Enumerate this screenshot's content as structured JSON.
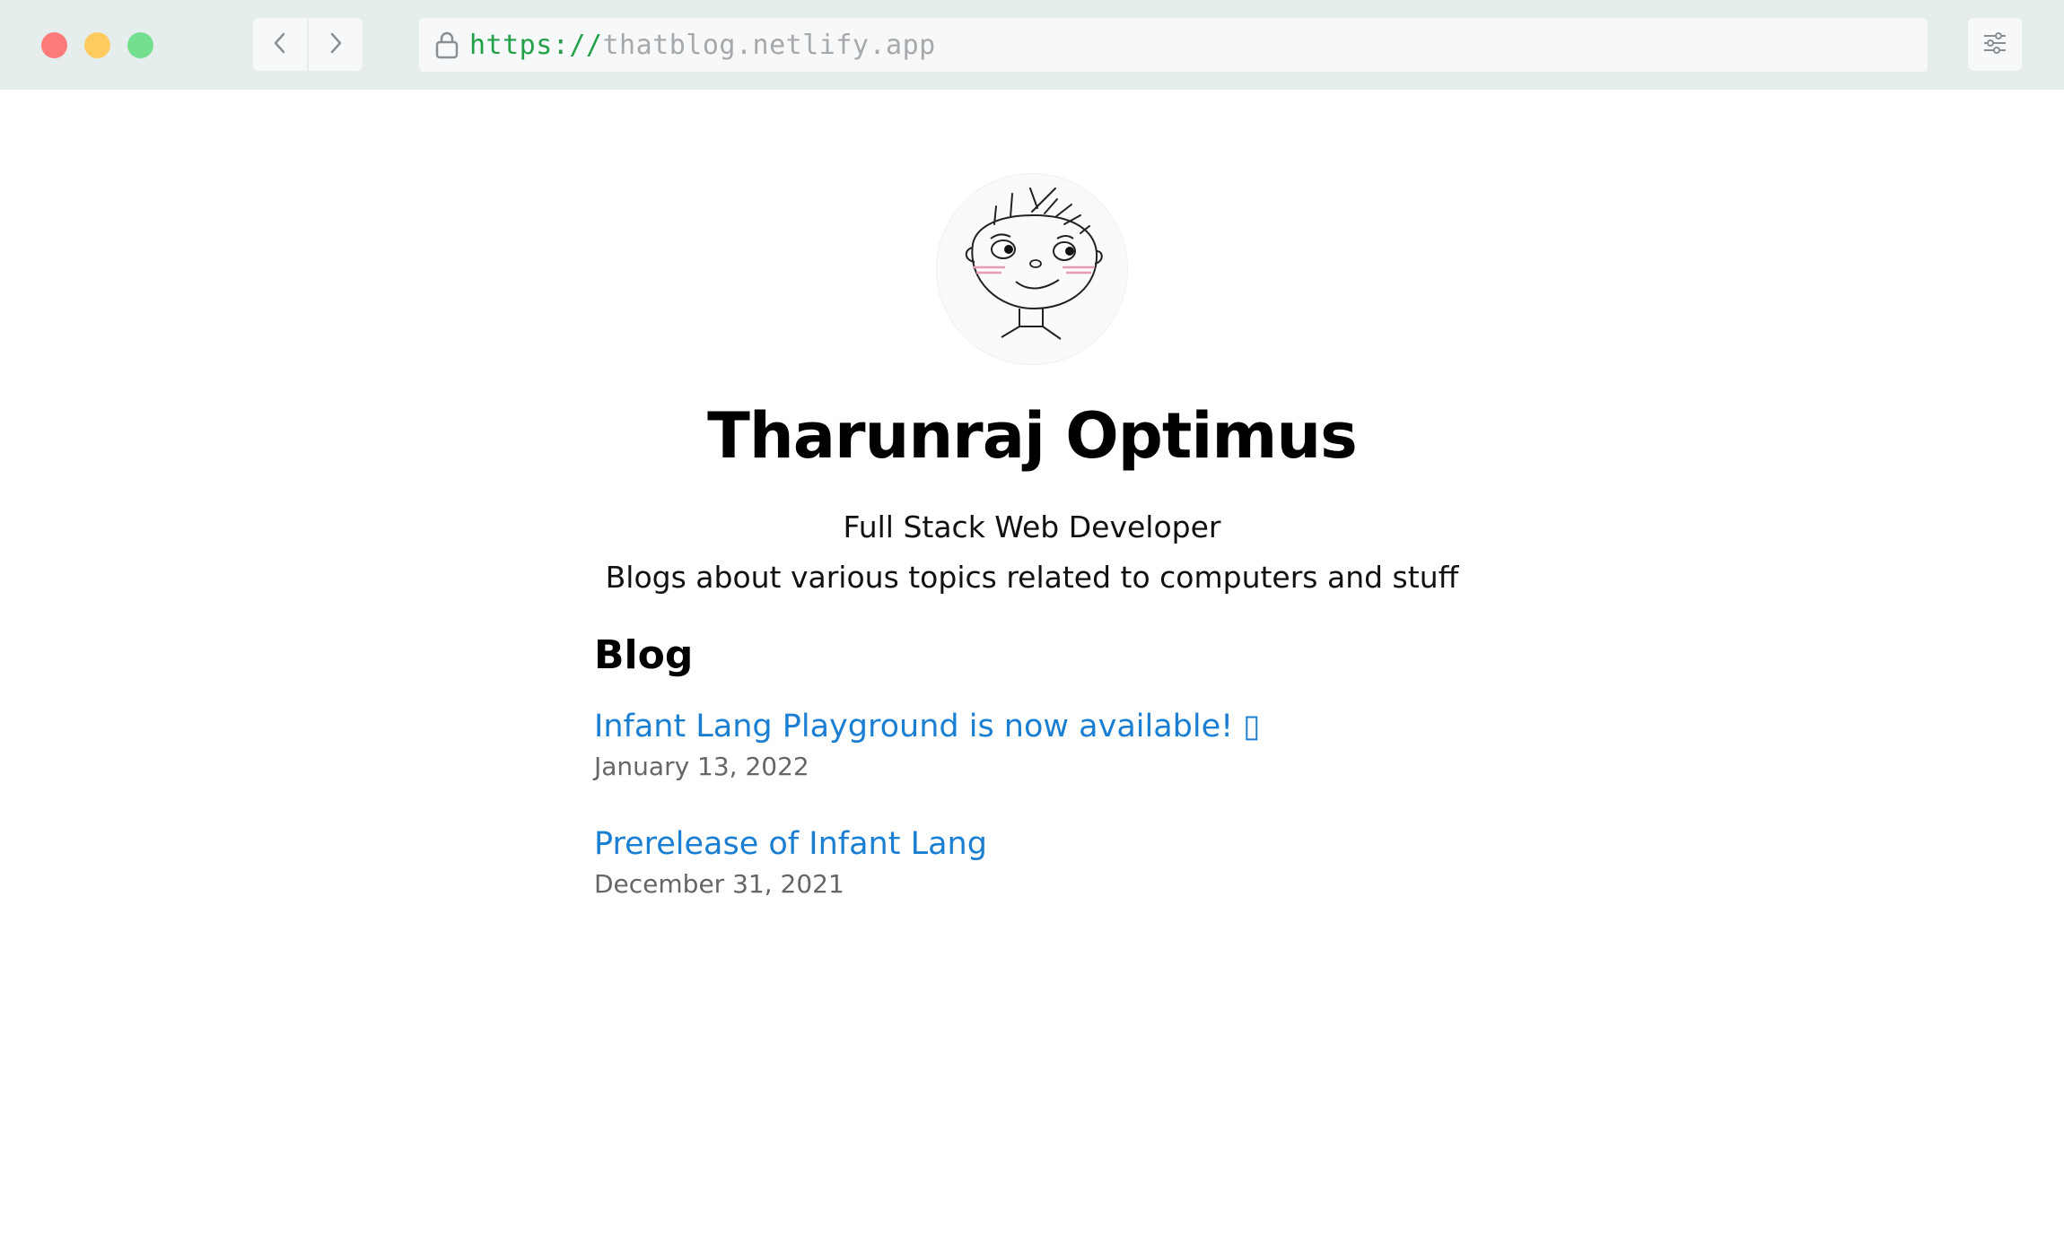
{
  "browser": {
    "url_scheme": "https://",
    "url_host": "thatblog.netlify.app",
    "icons": [
      "back-icon",
      "forward-icon",
      "lock-icon",
      "settings-icon"
    ]
  },
  "profile": {
    "name": "Tharunraj Optimus",
    "tagline": "Full Stack Web Developer",
    "description": "Blogs about various topics related to computers and stuff"
  },
  "blog": {
    "heading": "Blog",
    "posts": [
      {
        "title": "Infant Lang Playground is now available! ▯",
        "date": "January 13, 2022"
      },
      {
        "title": "Prerelease of Infant Lang",
        "date": "December 31, 2021"
      }
    ]
  },
  "colors": {
    "chrome_bg": "#e6eded",
    "link": "#1a7fd2",
    "url_scheme": "#24a148",
    "url_host": "#a6a9ab"
  }
}
